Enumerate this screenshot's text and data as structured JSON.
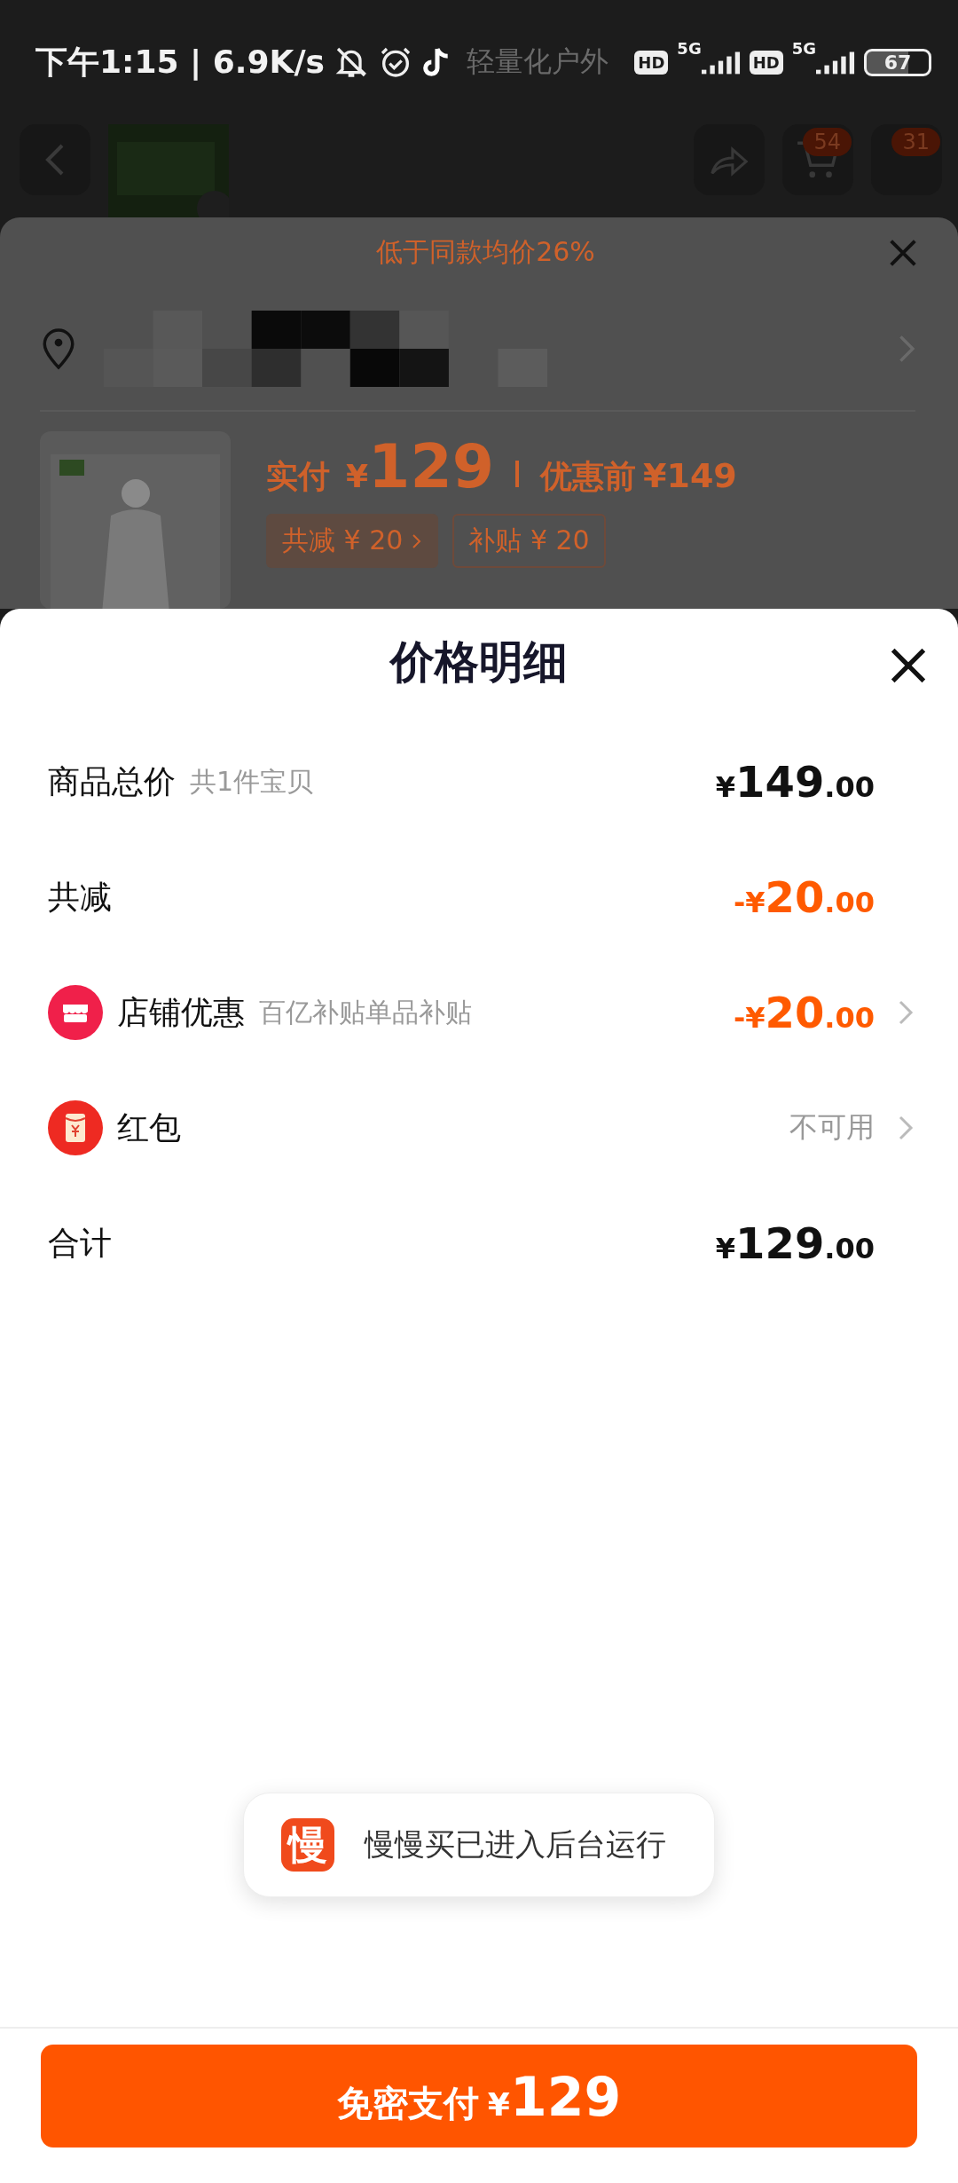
{
  "status_bar": {
    "time": "下午1:15 | 6.9K/s",
    "background_title": "轻量化户外",
    "sims": [
      {
        "hd": "HD",
        "network": "5G"
      },
      {
        "hd": "HD",
        "network": "5G"
      }
    ],
    "battery": "67"
  },
  "nav": {
    "badges": [
      {
        "count": "54"
      },
      {
        "count": "31"
      }
    ]
  },
  "order_sheet": {
    "banner": "低于同款均价26%",
    "price_label": "实付",
    "price_currency": "¥",
    "price": "129",
    "before_label": "优惠前",
    "before_price": "¥149",
    "tags": [
      {
        "label": "共减 ¥ 20",
        "chevron": true,
        "filled": true
      },
      {
        "label": "补贴 ¥ 20",
        "chevron": false,
        "filled": false
      }
    ]
  },
  "detail_sheet": {
    "title": "价格明细",
    "rows": [
      {
        "label": "商品总价",
        "note": "共1件宝贝",
        "kind": "plain",
        "amount": {
          "currency": "¥",
          "whole": "149",
          "cents": ".00"
        },
        "highlight": false,
        "chevron": false
      },
      {
        "label": "共减",
        "kind": "plain",
        "amount": {
          "currency": "-¥",
          "whole": "20",
          "cents": ".00"
        },
        "highlight": true,
        "chevron": false
      },
      {
        "label": "店铺优惠",
        "note": "百亿补贴单品补贴",
        "kind": "shop",
        "amount": {
          "currency": "-¥",
          "whole": "20",
          "cents": ".00"
        },
        "highlight": true,
        "chevron": true
      },
      {
        "label": "红包",
        "kind": "packet",
        "status": "不可用",
        "chevron": true
      },
      {
        "label": "合计",
        "kind": "plain",
        "amount": {
          "currency": "¥",
          "whole": "129",
          "cents": ".00"
        },
        "highlight": false,
        "chevron": false
      }
    ]
  },
  "toast": {
    "app_icon_text": "慢",
    "message": "慢慢买已进入后台运行"
  },
  "pay_button": {
    "label": "免密支付",
    "currency": "¥",
    "amount": "129"
  }
}
